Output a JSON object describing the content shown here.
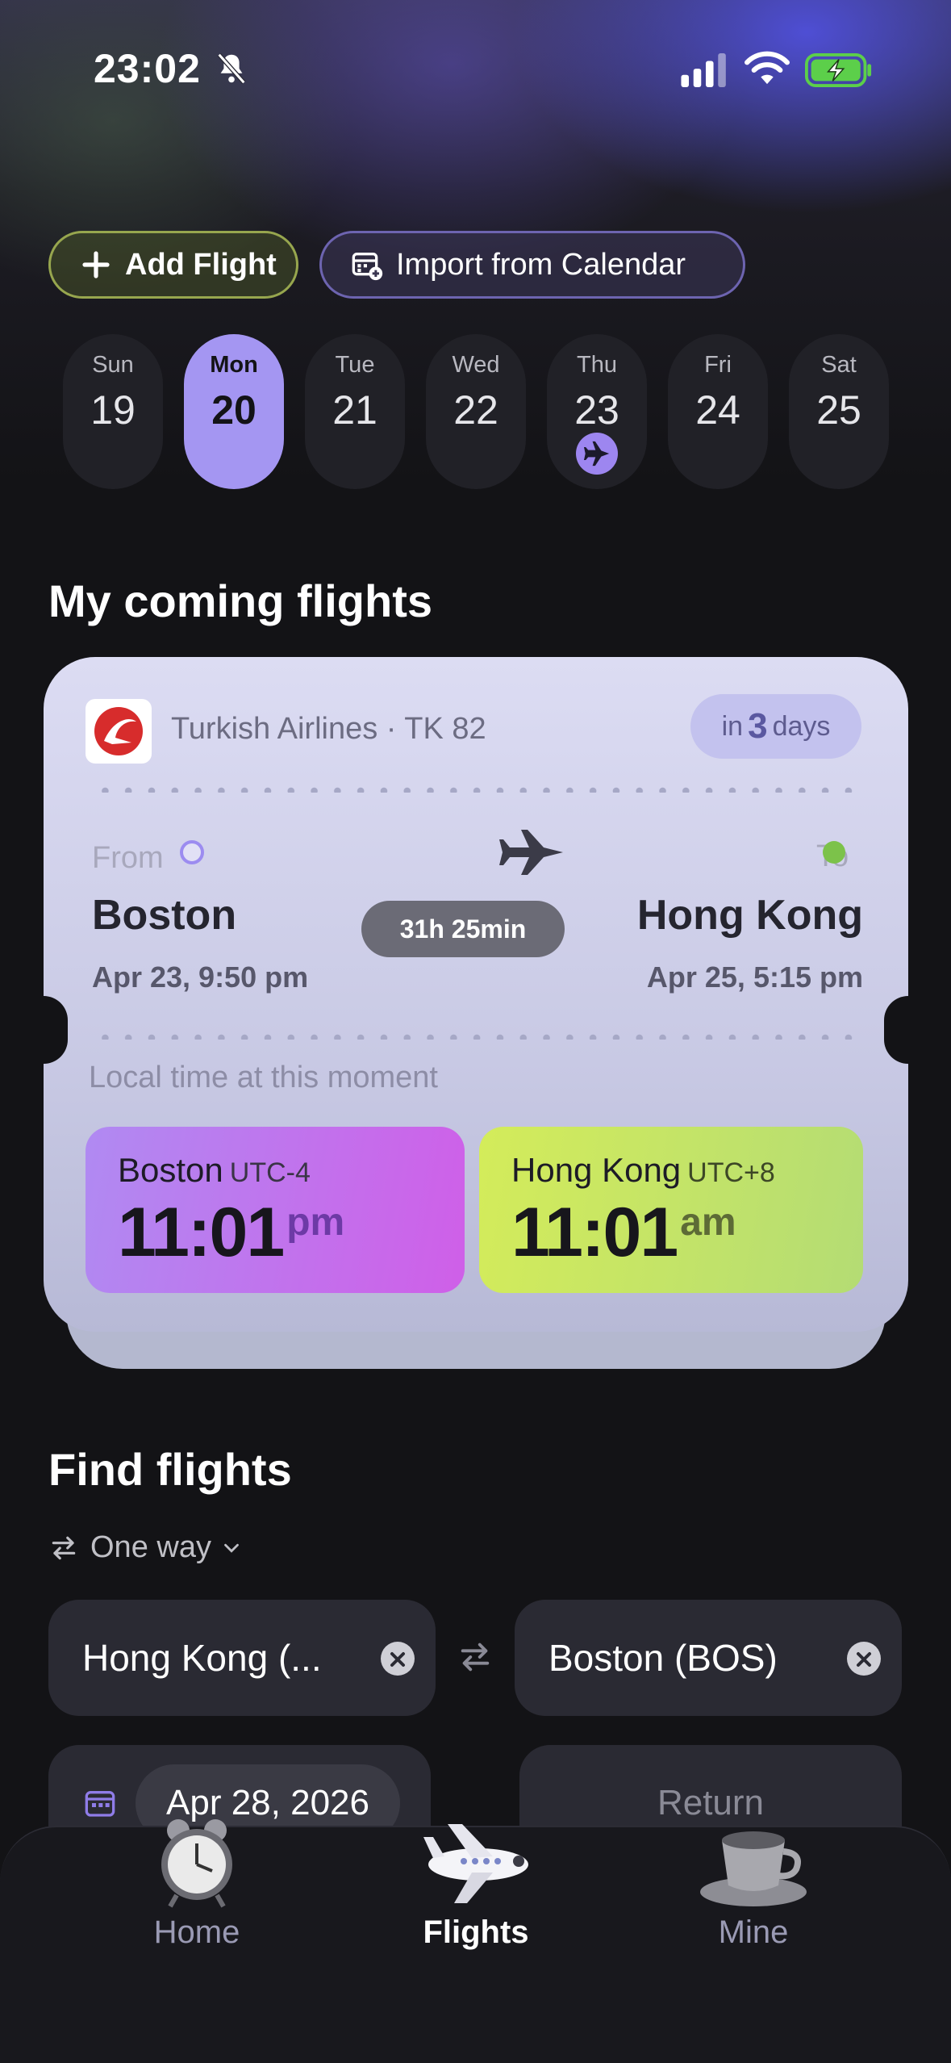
{
  "status_bar": {
    "time": "23:02",
    "icons": [
      "bell-slash-icon",
      "cellular-signal-icon",
      "wifi-icon",
      "battery-charging-icon"
    ]
  },
  "actions": {
    "add_flight": "Add Flight",
    "import_calendar": "Import from Calendar"
  },
  "week": [
    {
      "day": "Sun",
      "date": "19",
      "selected": false,
      "has_flight": false
    },
    {
      "day": "Mon",
      "date": "20",
      "selected": true,
      "has_flight": false
    },
    {
      "day": "Tue",
      "date": "21",
      "selected": false,
      "has_flight": false
    },
    {
      "day": "Wed",
      "date": "22",
      "selected": false,
      "has_flight": false
    },
    {
      "day": "Thu",
      "date": "23",
      "selected": false,
      "has_flight": true
    },
    {
      "day": "Fri",
      "date": "24",
      "selected": false,
      "has_flight": false
    },
    {
      "day": "Sat",
      "date": "25",
      "selected": false,
      "has_flight": false
    }
  ],
  "coming_flights": {
    "title": "My coming flights",
    "flight": {
      "airline": "Turkish Airlines · TK 82",
      "countdown": {
        "prefix": "in",
        "value": "3",
        "suffix": "days"
      },
      "from_label": "From",
      "to_label": "To",
      "origin_city": "Boston",
      "origin_datetime": "Apr 23, 9:50 pm",
      "destination_city": "Hong Kong",
      "destination_datetime": "Apr 25, 5:15 pm",
      "duration": "31h 25min",
      "local_time_label": "Local time at this moment",
      "local_times": [
        {
          "city": "Boston",
          "offset": "UTC-4",
          "time": "11:01",
          "ampm": "pm"
        },
        {
          "city": "Hong Kong",
          "offset": "UTC+8",
          "time": "11:01",
          "ampm": "am"
        }
      ]
    }
  },
  "find_flights": {
    "title": "Find flights",
    "trip_type": "One way",
    "from_value": "Hong Kong (...",
    "to_value": "Boston (BOS)",
    "depart_date": "Apr 28, 2026",
    "return_placeholder": "Return"
  },
  "tabs": [
    {
      "label": "Home",
      "icon": "alarm-clock-icon",
      "active": false
    },
    {
      "label": "Flights",
      "icon": "airplane-icon",
      "active": true
    },
    {
      "label": "Mine",
      "icon": "teacup-icon",
      "active": false
    }
  ],
  "colors": {
    "accent_purple": "#a496f2",
    "accent_green": "#97a64e",
    "boston_card": "#cf5fe8",
    "hongkong_card": "#c6e568"
  }
}
